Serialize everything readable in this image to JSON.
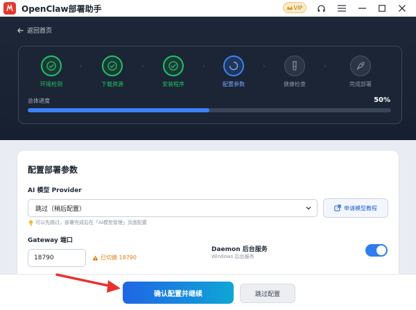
{
  "app": {
    "title": "OpenClaw部署助手",
    "vip_label": "VIP"
  },
  "nav": {
    "back_label": "返回首页"
  },
  "steps": [
    {
      "label": "环境检测",
      "state": "done",
      "icon": "check-icon"
    },
    {
      "label": "下载资源",
      "state": "done",
      "icon": "check-icon"
    },
    {
      "label": "安装程序",
      "state": "done",
      "icon": "check-icon"
    },
    {
      "label": "配置参数",
      "state": "active",
      "icon": "spinner-icon"
    },
    {
      "label": "健康检查",
      "state": "pending",
      "icon": "test-tube-icon"
    },
    {
      "label": "完成部署",
      "state": "pending",
      "icon": "rocket-icon"
    }
  ],
  "progress": {
    "label": "总体进度",
    "percent_text": "50%",
    "value": 0.5
  },
  "config": {
    "title": "配置部署参数",
    "provider_label": "AI 模型 Provider",
    "provider_selected": "跳过（稍后配置）",
    "tutorial_button": "申请模型教程",
    "hint": "可以先跳过，部署完成后在「AI模型管理」页面配置",
    "gateway_label": "Gateway 端口",
    "gateway_port": "18790",
    "port_warning": "已切换 18790",
    "daemon_title": "Daemon 后台服务",
    "daemon_subtitle": "Windows 后台服务",
    "daemon_enabled": true
  },
  "actions": {
    "confirm": "确认配置并继续",
    "skip": "跳过配置"
  },
  "colors": {
    "done": "#22c55e",
    "active": "#3f83f8",
    "primary": "#1f66e5",
    "warning": "#e07a0f",
    "header_bg": "#1d2738"
  }
}
